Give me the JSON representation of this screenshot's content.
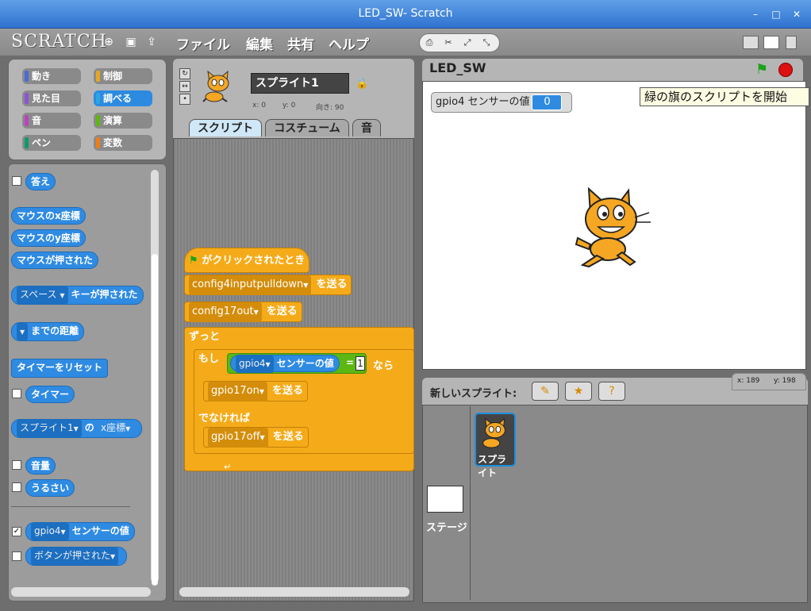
{
  "window": {
    "title": "LED_SW- Scratch"
  },
  "menu": {
    "logo": "SCRATCH",
    "items": [
      "ファイル",
      "編集",
      "共有",
      "ヘルプ"
    ]
  },
  "categories": [
    {
      "label": "動き",
      "color": "#4a6cd4"
    },
    {
      "label": "制御",
      "color": "#e6a822"
    },
    {
      "label": "見た目",
      "color": "#8a55d7"
    },
    {
      "label": "調べる",
      "color": "#2ca5e2"
    },
    {
      "label": "音",
      "color": "#bb42c3"
    },
    {
      "label": "演算",
      "color": "#5cb712"
    },
    {
      "label": "ペン",
      "color": "#0e9a6c"
    },
    {
      "label": "変数",
      "color": "#ee7d16"
    }
  ],
  "palette": {
    "answer": "答え",
    "mouse_x": "マウスのx座標",
    "mouse_y": "マウスのy座標",
    "mouse_down": "マウスが押された",
    "key_dd": "スペース",
    "key_pressed": "キーが押された",
    "distance_suffix": "までの距離",
    "reset_timer": "タイマーをリセット",
    "timer": "タイマー",
    "of_sprite": "スプライト1",
    "of_label": "の",
    "of_attr": "x座標",
    "loudness": "音量",
    "loud": "うるさい",
    "sensor_dd": "gpio4",
    "sensor_label": "センサーの値",
    "button_pressed": "ボタンが押された"
  },
  "sprite": {
    "name": "スプライト1",
    "x_label": "x: 0",
    "y_label": "y: 0",
    "dir_label": "向き: 90"
  },
  "tabs": [
    "スクリプト",
    "コスチューム",
    "音"
  ],
  "script": {
    "hat": "がクリックされたとき",
    "b1_dd": "config4inputpulldown",
    "b1_label": "を送る",
    "b2_dd": "config17out",
    "b2_label": "を送る",
    "forever": "ずっと",
    "if_label": "もし",
    "if_dd": "gpio4",
    "if_sensor": "センサーの値",
    "if_eq": "=",
    "if_val": "1",
    "if_then": "なら",
    "b3_dd": "gpio17on",
    "b3_label": "を送る",
    "else_label": "でなければ",
    "b4_dd": "gpio17off",
    "b4_label": "を送る"
  },
  "stage": {
    "title": "LED_SW",
    "monitor_label": "gpio4 センサーの値",
    "monitor_value": "0",
    "tooltip": "緑の旗のスクリプトを開始",
    "mouse_x": "x: 189",
    "mouse_y": "y: 198"
  },
  "sprites_pane": {
    "new_sprite_label": "新しいスプライト:",
    "stage_label": "ステージ",
    "sprite_label": "スプライト"
  }
}
